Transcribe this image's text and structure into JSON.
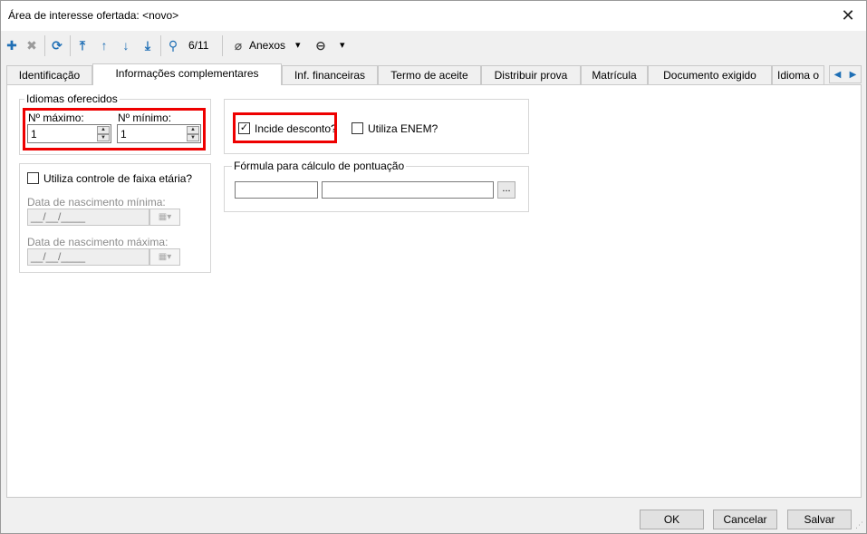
{
  "window": {
    "title": "Área de interesse ofertada: <novo>",
    "close_glyph": "✕"
  },
  "toolbar": {
    "icons": [
      "add-icon",
      "delete-icon",
      "refresh-icon",
      "first-icon",
      "up-icon",
      "down-icon",
      "last-icon",
      "search-icon",
      "paperclip-icon",
      "options-icon"
    ],
    "glyphs": {
      "add": "✚",
      "delete": "✖",
      "refresh": "⟳",
      "first": "⤒",
      "up": "↑",
      "down": "↓",
      "last": "⤓",
      "search": "⚲",
      "paperclip": "⌀",
      "options": "⊖",
      "chevron": "▾"
    },
    "record_counter": "6/11",
    "attachments_label": "Anexos"
  },
  "tabs": [
    {
      "label": "Identificação",
      "active": false
    },
    {
      "label": "Informações complementares",
      "active": true
    },
    {
      "label": "Inf. financeiras",
      "active": false
    },
    {
      "label": "Termo de aceite",
      "active": false
    },
    {
      "label": "Distribuir prova",
      "active": false
    },
    {
      "label": "Matrícula",
      "active": false
    },
    {
      "label": "Documento exigido",
      "active": false
    },
    {
      "label": "Idioma o",
      "active": false
    }
  ],
  "tab_scroll": {
    "left": "◀",
    "right": "▶"
  },
  "idiomas": {
    "group_title": "Idiomas oferecidos",
    "max_label": "Nº máximo:",
    "max_value": "1",
    "min_label": "Nº mínimo:",
    "min_value": "1",
    "spin_up": "▲",
    "spin_down": "▼"
  },
  "faixa": {
    "checkbox_label": "Utiliza controle de faixa etária?",
    "checked": false,
    "min_date_label": "Data de nascimento mínima:",
    "min_date_value": "__/__/____",
    "max_date_label": "Data de nascimento máxima:",
    "max_date_value": "__/__/____",
    "dropdown_glyph": "▦▾"
  },
  "desconto": {
    "label": "Incide desconto?",
    "checked": true,
    "check_glyph": "✓"
  },
  "enem": {
    "label": "Utiliza ENEM?",
    "checked": false
  },
  "formula": {
    "group_title": "Fórmula para cálculo de pontuação",
    "field1_value": "",
    "field2_value": "",
    "ellipsis": "..."
  },
  "buttons": {
    "ok": "OK",
    "cancel": "Cancelar",
    "save": "Salvar"
  },
  "colors": {
    "accent": "#1f6fb5",
    "highlight": "#ee0000"
  }
}
